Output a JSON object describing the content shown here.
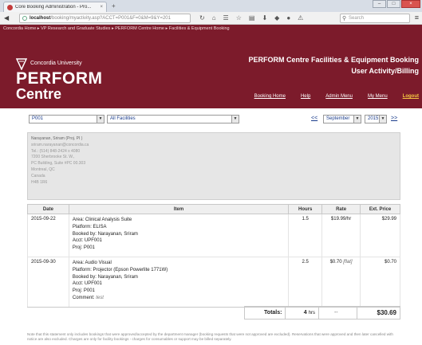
{
  "browser": {
    "tab_title": "Core Booking Administration - Pro...",
    "tab_close": "×",
    "new_tab": "+",
    "url_host": "localhost",
    "url_path": "/booking/myactivity.asp?ACCT=P001&F=0&M=9&Y=201",
    "search_placeholder": "Search",
    "window_buttons": [
      "–",
      "□",
      "×"
    ]
  },
  "header": {
    "breadcrumb": "Concordia Home ▸ VP Research and Graduate Studies ▸ PERFORM Centre Home ▸ Facilities & Equipment Booking",
    "university": "Concordia University",
    "logo_line1": "PERFORM",
    "logo_line2": "Centre",
    "title_line1": "PERFORM Centre Facilities & Equipment Booking",
    "title_line2": "User Activity/Billing",
    "links": [
      "Booking Home",
      "Help",
      "Admin Menu",
      "My Menu",
      "Logout"
    ]
  },
  "filters": {
    "account": "P001",
    "facility": "All Facilities",
    "prev": "<<",
    "month": "September",
    "year": "2015",
    "next": ">>"
  },
  "address": {
    "lines": [
      "Narayanan, Sriram (Proj. PI )",
      "sriram.narayanan@concordia.ca",
      "Tel.: (514) 848-2424 x 4080",
      "7200 Sherbrooke St. W.,",
      "PC Building, Suite #PC 00.303",
      "Montreal, QC",
      "Canada",
      "H4B 1R6"
    ]
  },
  "table": {
    "headers": [
      "Date",
      "Item",
      "Hours",
      "Rate",
      "Ext. Price"
    ],
    "rows": [
      {
        "date": "2015-09-22",
        "area": "Area: Clinical Analysis Suite",
        "platform": "Platform: ELISA",
        "booked_by": "Booked by: Narayanan, Sriram",
        "acct": "Acct: UPF001",
        "proj": "Proj: P001",
        "hours": "1.5",
        "rate": "$19.99/hr",
        "ext": "$29.99"
      },
      {
        "date": "2015-09-30",
        "area": "Area: Audio Visual",
        "platform": "Platform: Projector (Epson Powerlite 1771W)",
        "booked_by": "Booked by: Narayanan, Sriram",
        "acct": "Acct: UPF001",
        "proj": "Proj: P001",
        "comment_label": "Comment:",
        "comment": "test",
        "hours": "2.5",
        "rate": "$0.70",
        "rate_note": "[flat]",
        "ext": "$0.70"
      }
    ]
  },
  "totals": {
    "label": "Totals:",
    "hours": "4",
    "hours_unit": "hrs",
    "rate": "--",
    "ext": "$30.69"
  },
  "footnote": "Note that this statement only includes bookings that were approved/accepted by the department manager (booking requests that were not approved are excluded). Reservations that were approved and then later cancelled with notice are also excluded. Charges are only for facility bookings - charges for consumables or support may be billed separately.",
  "colors": {
    "brand": "#7c1b2b",
    "link": "#1a3c8c",
    "logout": "#f4c542"
  }
}
